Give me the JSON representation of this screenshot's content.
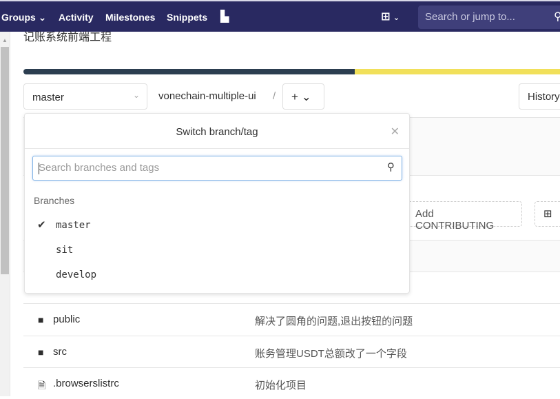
{
  "nav": {
    "items": [
      "Groups ⌄",
      "Activity",
      "Milestones",
      "Snippets"
    ],
    "chart_icon": "chart-icon",
    "new_icon": "plus-square-icon",
    "search_placeholder": "Search or jump to...",
    "search_icon": "search-icon"
  },
  "project": {
    "description": "记账系统前端工程"
  },
  "language_bar": {
    "colors": [
      "#2c3e50",
      "#f1e05a"
    ],
    "percents": [
      66,
      34
    ]
  },
  "repo": {
    "branch": "master",
    "path": "vonechain-multiple-ui",
    "separator": "/",
    "add_label": "+ ⌄",
    "history_label": "History"
  },
  "dropdown": {
    "title": "Switch branch/tag",
    "search_placeholder": "Search branches and tags",
    "section": "Branches",
    "branches": [
      "master",
      "sit",
      "develop"
    ],
    "selected": "master"
  },
  "actions": {
    "add_contributing": "Add CONTRIBUTING"
  },
  "files": [
    {
      "type": "folder",
      "name": "public",
      "message": "解决了圆角的问题,退出按钮的问题"
    },
    {
      "type": "folder",
      "name": "src",
      "message": "账务管理USDT总额改了一个字段"
    },
    {
      "type": "file",
      "name": ".browserslistrc",
      "message": "初始化项目"
    }
  ]
}
